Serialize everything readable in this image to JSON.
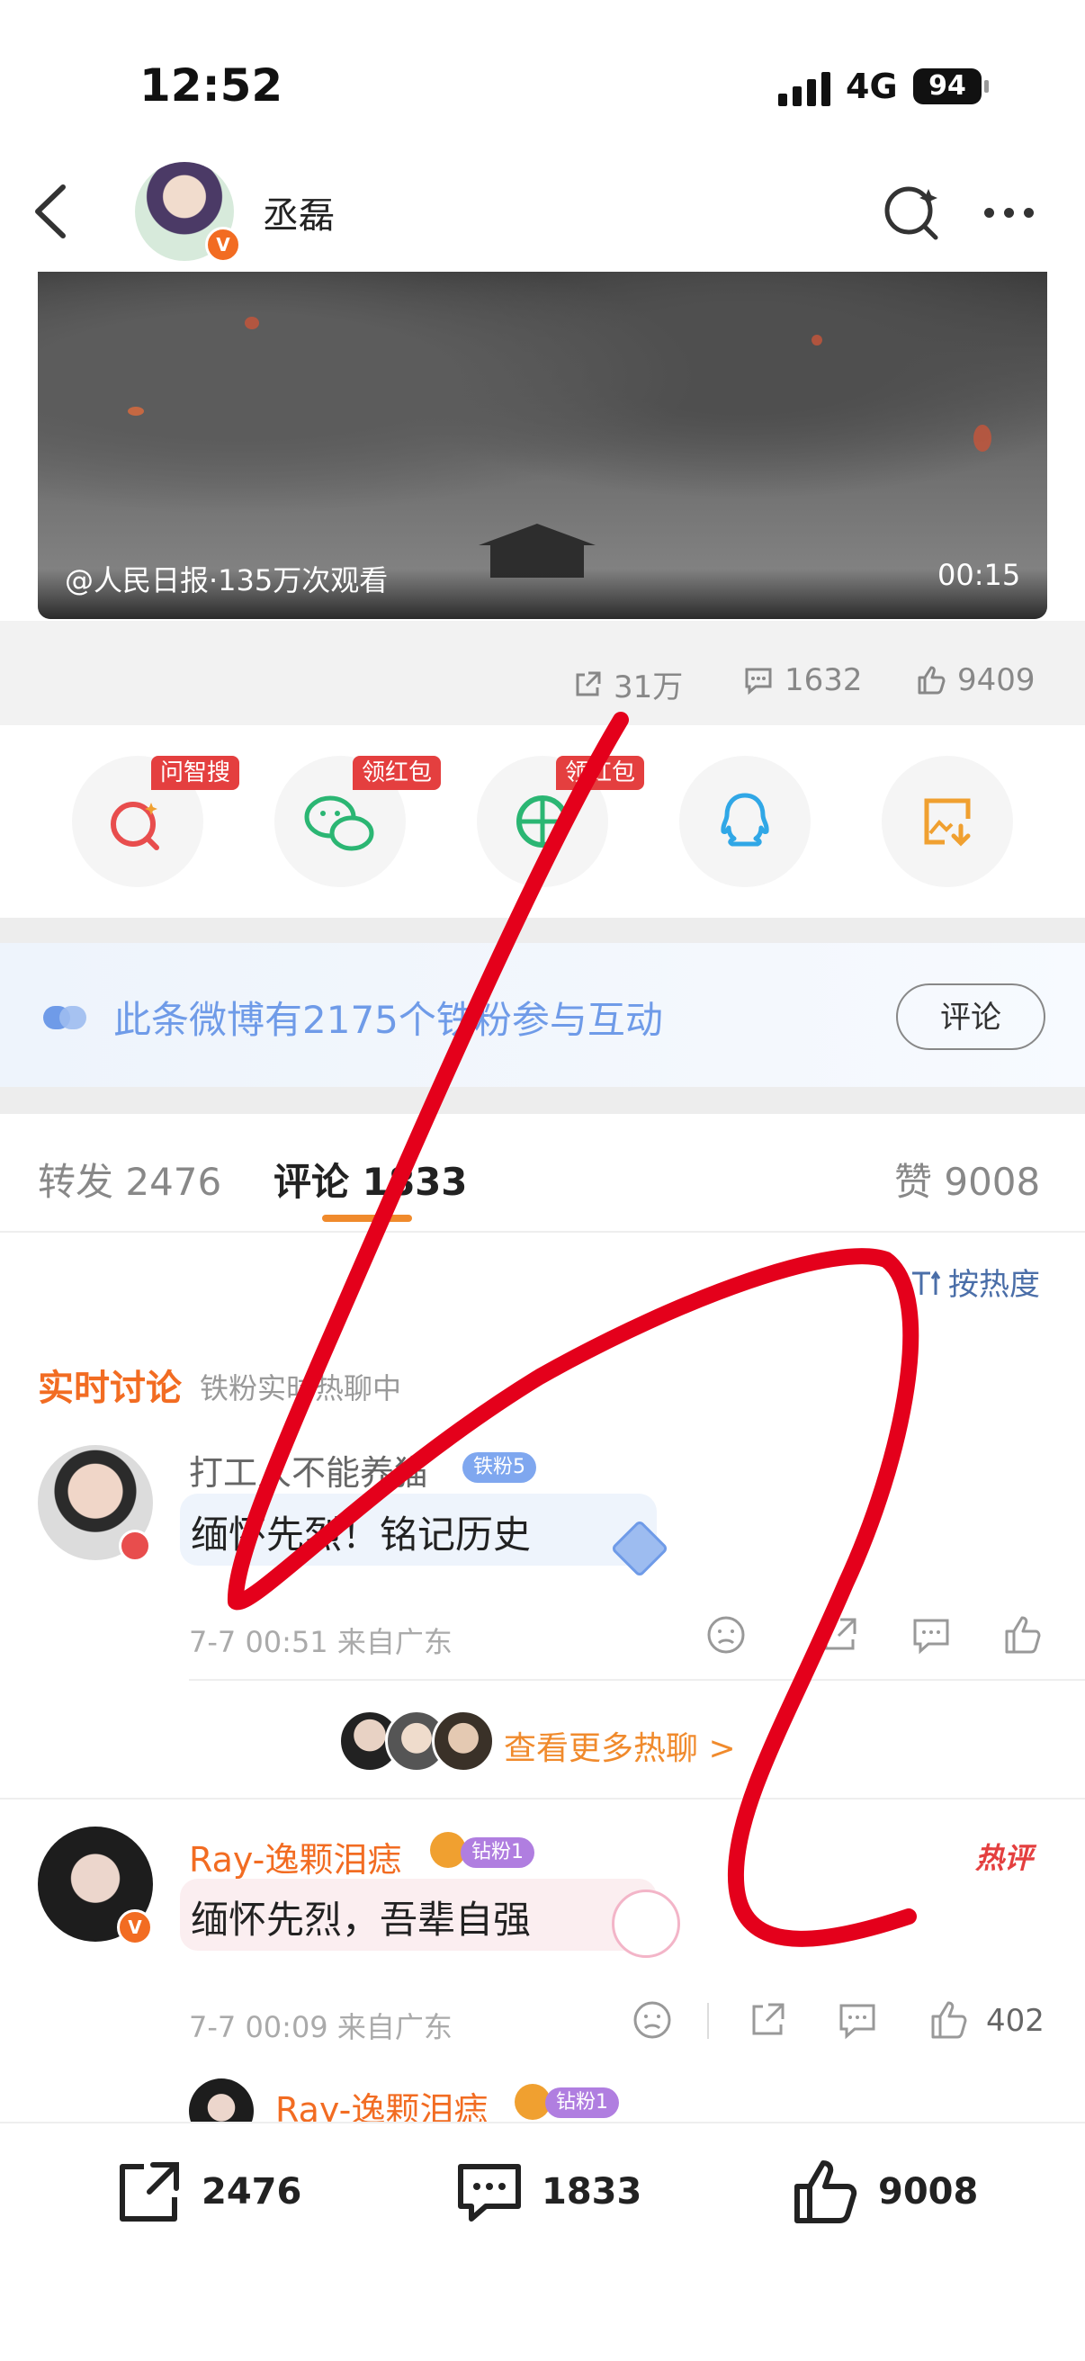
{
  "status_bar": {
    "time": "12:52",
    "network": "4G",
    "battery": "94"
  },
  "nav": {
    "title": "丞磊"
  },
  "video": {
    "source": "@人民日报·135万次观看",
    "duration": "00:15"
  },
  "stats": {
    "reposts": "31万",
    "comments": "1632",
    "likes": "9409"
  },
  "share": {
    "tags": [
      "问智搜",
      "领红包",
      "领红包"
    ]
  },
  "fans_banner": {
    "text": "此条微博有2175个铁粉参与互动",
    "button": "评论"
  },
  "tabs": {
    "repost": "转发 2476",
    "comment": "评论 1833",
    "like": "赞 9008"
  },
  "sort": {
    "label": "按热度"
  },
  "live": {
    "title": "实时讨论",
    "subtitle": "铁粉实时热聊中"
  },
  "comments": [
    {
      "name": "打工人不能养猫",
      "badge": "铁粉5",
      "text": "缅怀先烈！铭记历史",
      "meta": "7-7 00:51 来自广东"
    },
    {
      "name": "Ray-逸颗泪痣",
      "badge": "钻粉1",
      "text": "缅怀先烈，吾辈自强",
      "meta": "7-7 00:09 来自广东",
      "like_count": "402",
      "hot": "热评"
    }
  ],
  "reply_preview": {
    "name": "Ray-逸颗泪痣",
    "badge": "钻粉1"
  },
  "more_hot": "查看更多热聊 >",
  "bottom_bar": {
    "repost": "2476",
    "comment": "1833",
    "like": "9008"
  },
  "colors": {
    "accent": "#f08a2c",
    "badge_blue": "#6f9be8",
    "badge_purple": "#b07ee0",
    "annotation": "#e4001b"
  }
}
